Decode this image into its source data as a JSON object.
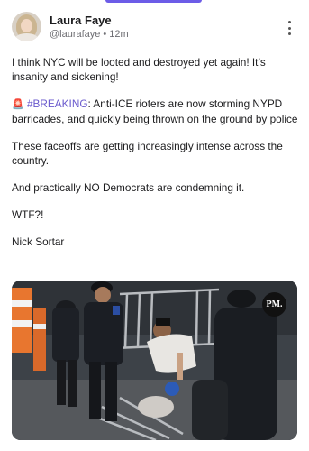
{
  "post": {
    "author_name": "Laura Faye",
    "handle": "@laurafaye",
    "separator": "•",
    "time_ago": "12m",
    "paragraphs": {
      "p1": "I think NYC will be looted and destroyed yet again! It’s insanity and sickening!",
      "p2_emoji": "🚨",
      "p2_hashtag": "#BREAKING",
      "p2_rest": ": Anti-ICE rioters are now storming NYPD barricades, and quickly being thrown on the ground by police",
      "p3": "These faceoffs are getting increasingly intense across the country.",
      "p4": "And practically NO Democrats are condemning it.",
      "p5": "WTF?!",
      "p6": "Nick Sortar"
    },
    "media": {
      "watermark": "PM.",
      "description_icon": "video-still"
    }
  },
  "icons": {
    "more": "more-vertical-icon",
    "siren": "police-light-icon"
  },
  "colors": {
    "accent": "#6c5ce7",
    "hashtag": "#6a5acd",
    "text": "#1c1c1e",
    "muted": "#6e6e73"
  }
}
